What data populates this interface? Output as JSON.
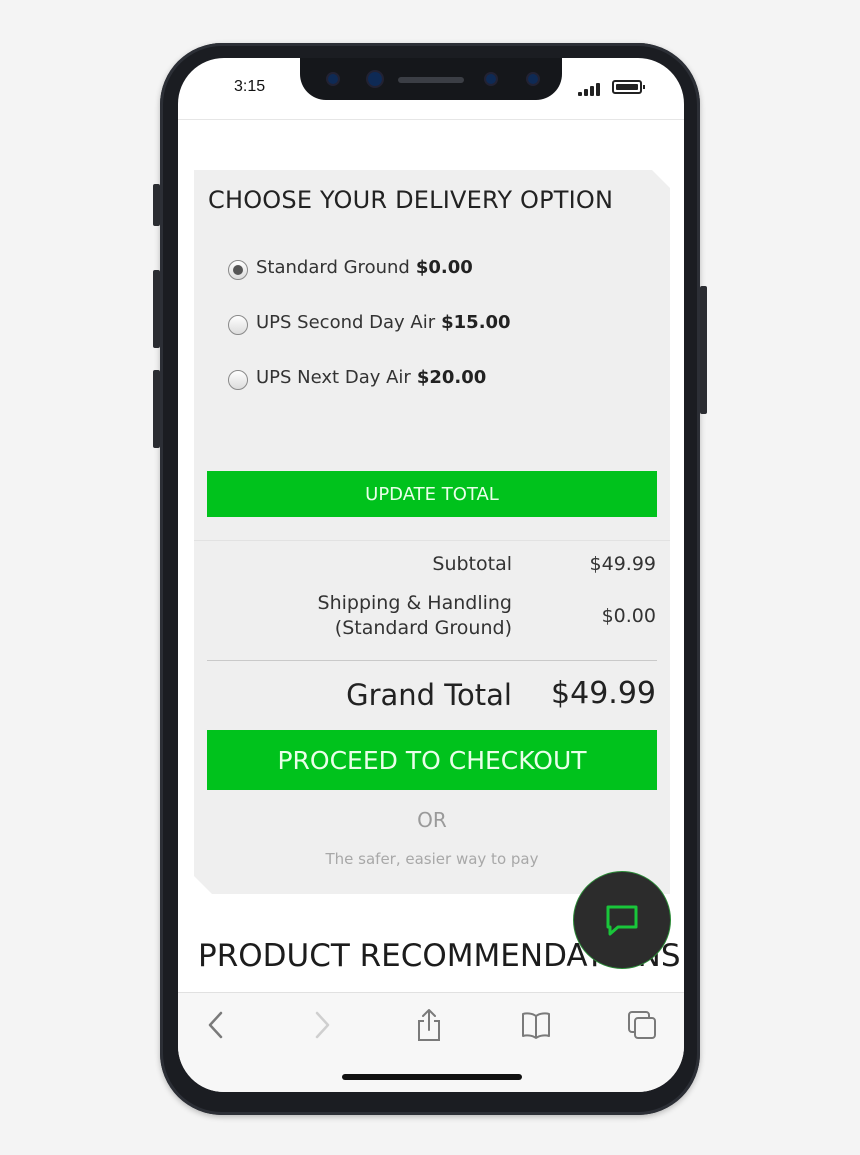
{
  "status_bar": {
    "time": "3:15"
  },
  "delivery": {
    "title": "CHOOSE YOUR DELIVERY OPTION",
    "options": [
      {
        "label": "Standard Ground",
        "price": "$0.00",
        "selected": true
      },
      {
        "label": "UPS Second Day Air",
        "price": "$15.00",
        "selected": false
      },
      {
        "label": "UPS Next Day Air",
        "price": "$20.00",
        "selected": false
      }
    ],
    "update_button": "UPDATE TOTAL"
  },
  "summary": {
    "subtotal_label": "Subtotal",
    "subtotal_value": "$49.99",
    "shipping_label_line1": "Shipping & Handling",
    "shipping_label_line2": "(Standard Ground)",
    "shipping_value": "$0.00",
    "grand_total_label": "Grand Total",
    "grand_total_value": "$49.99"
  },
  "checkout": {
    "proceed_button": "PROCEED TO CHECKOUT",
    "or_text": "OR",
    "safer_text": "The safer, easier way to pay"
  },
  "recommendations": {
    "title": "PRODUCT RECOMMENDATIONS"
  },
  "icons": {
    "chat": "chat-bubble-icon",
    "back": "chevron-left-icon",
    "forward": "chevron-right-icon",
    "share": "share-icon",
    "bookmarks": "book-icon",
    "tabs": "tabs-icon"
  },
  "colors": {
    "accent": "#00c21c",
    "panel": "#efefef"
  }
}
